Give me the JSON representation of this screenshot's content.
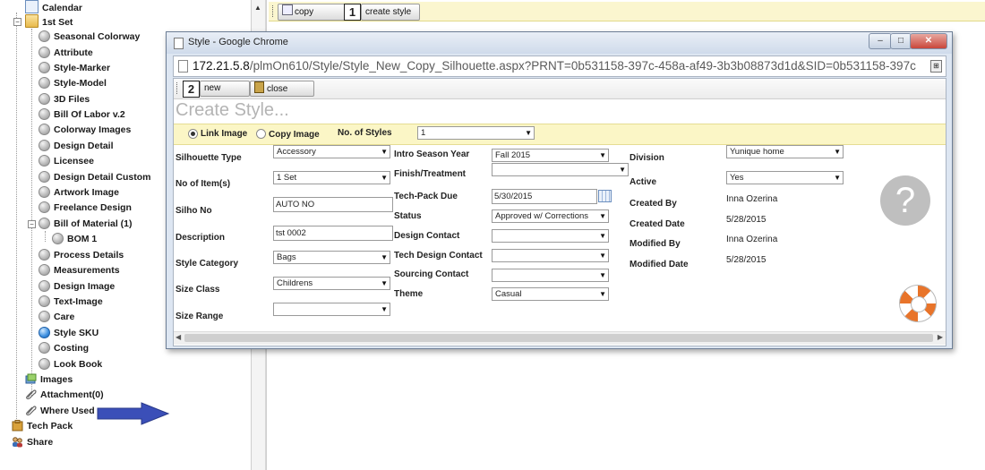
{
  "tree": {
    "items": [
      {
        "label": "Calendar"
      },
      {
        "label": "1st Set"
      },
      {
        "label": "Seasonal Colorway"
      },
      {
        "label": "Attribute"
      },
      {
        "label": "Style-Marker"
      },
      {
        "label": "Style-Model"
      },
      {
        "label": "3D Files"
      },
      {
        "label": "Bill Of Labor v.2"
      },
      {
        "label": "Colorway Images"
      },
      {
        "label": "Design Detail"
      },
      {
        "label": "Licensee"
      },
      {
        "label": "Design Detail Custom"
      },
      {
        "label": "Artwork Image"
      },
      {
        "label": "Freelance Design"
      },
      {
        "label": "Bill of Material (1)"
      },
      {
        "label": "BOM 1"
      },
      {
        "label": "Process Details"
      },
      {
        "label": "Measurements"
      },
      {
        "label": "Design Image"
      },
      {
        "label": "Text-Image"
      },
      {
        "label": "Care"
      },
      {
        "label": "Style SKU"
      },
      {
        "label": "Costing"
      },
      {
        "label": "Look Book"
      },
      {
        "label": "Images"
      },
      {
        "label": "Attachment(0)"
      },
      {
        "label": "Where Used"
      },
      {
        "label": "Tech Pack"
      },
      {
        "label": "Share"
      }
    ]
  },
  "toolbar": {
    "copy_label": "copy",
    "step1": "1",
    "create_style_label": "create style"
  },
  "popup": {
    "title": "Style - Google Chrome",
    "url_host": "172.21.5.8",
    "url_rest": "/plmOn610/Style/Style_New_Copy_Silhouette.aspx?PRNT=0b531158-397c-458a-af49-3b3b08873d1d&SID=0b531158-397c",
    "step2": "2",
    "new_label": "new",
    "close_label": "close",
    "heading": "Create Style...",
    "link_image_label": "Link Image",
    "copy_image_label": "Copy Image",
    "no_of_styles_label": "No. of Styles",
    "no_of_styles_value": "1",
    "help_glyph": "?"
  },
  "form": {
    "col1": [
      {
        "label": "Silhouette Type",
        "value": "Accessory",
        "kind": "select"
      },
      {
        "label": "No of Item(s)",
        "value": "1 Set",
        "kind": "select"
      },
      {
        "label": "Silho No",
        "value": "AUTO NO",
        "kind": "input"
      },
      {
        "label": "Description",
        "value": "tst 0002",
        "kind": "input"
      },
      {
        "label": "Style Category",
        "value": "Bags",
        "kind": "select"
      },
      {
        "label": "Size Class",
        "value": "Childrens",
        "kind": "select"
      },
      {
        "label": "Size Range",
        "value": "",
        "kind": "select"
      }
    ],
    "col2": [
      {
        "label": "Intro Season Year",
        "value": "Fall 2015",
        "kind": "select"
      },
      {
        "label": "Finish/Treatment",
        "value": "",
        "kind": "select"
      },
      {
        "label": "Tech-Pack Due",
        "value": "5/30/2015",
        "kind": "date"
      },
      {
        "label": "Status",
        "value": "Approved w/ Corrections",
        "kind": "select"
      },
      {
        "label": "Design Contact",
        "value": "",
        "kind": "select"
      },
      {
        "label": "Tech Design Contact",
        "value": "",
        "kind": "select"
      },
      {
        "label": "Sourcing Contact",
        "value": "",
        "kind": "select"
      },
      {
        "label": "Theme",
        "value": "Casual",
        "kind": "select"
      }
    ],
    "col3": [
      {
        "label": "Division",
        "value": "Yunique home",
        "kind": "select"
      },
      {
        "label": "Active",
        "value": "Yes",
        "kind": "select"
      },
      {
        "label": "Created By",
        "value": "Inna Ozerina",
        "kind": "text"
      },
      {
        "label": "Created Date",
        "value": "5/28/2015",
        "kind": "text"
      },
      {
        "label": "Modified By",
        "value": "Inna Ozerina",
        "kind": "text"
      },
      {
        "label": "Modified Date",
        "value": "5/28/2015",
        "kind": "text"
      }
    ]
  },
  "colors": {
    "toolbar_bg": "#fbf6cf",
    "arrow": "#3b4fb8"
  }
}
